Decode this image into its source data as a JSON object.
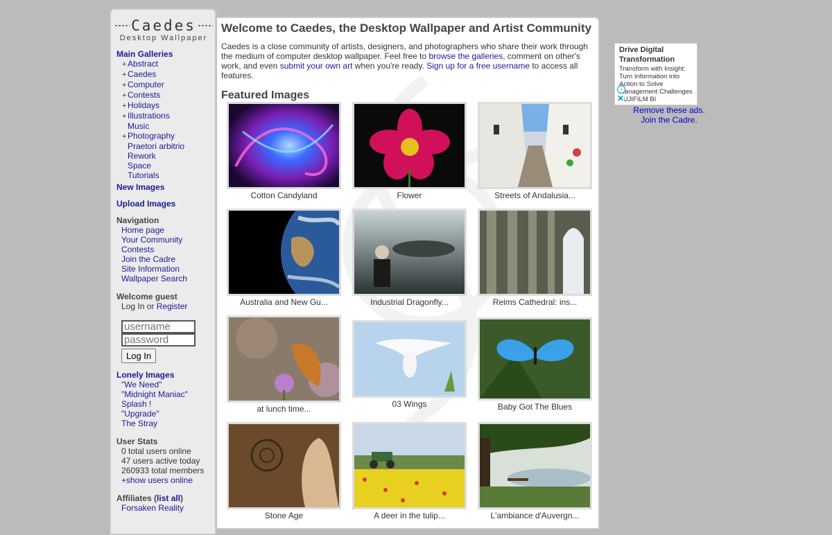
{
  "logo": {
    "brand": "Caedes",
    "subtitle": "Desktop Wallpaper"
  },
  "sidebar": {
    "main_galleries": {
      "title": "Main Galleries",
      "items": [
        {
          "label": "Abstract",
          "has_children": true
        },
        {
          "label": "Caedes",
          "has_children": true
        },
        {
          "label": "Computer",
          "has_children": true
        },
        {
          "label": "Contests",
          "has_children": true
        },
        {
          "label": "Holidays",
          "has_children": true
        },
        {
          "label": "Illustrations",
          "has_children": true
        },
        {
          "label": "Music",
          "has_children": false
        },
        {
          "label": "Photography",
          "has_children": true
        },
        {
          "label": "Praetori arbitrio",
          "has_children": false
        },
        {
          "label": "Rework",
          "has_children": false
        },
        {
          "label": "Space",
          "has_children": false
        },
        {
          "label": "Tutorials",
          "has_children": false
        }
      ]
    },
    "new_images": "New Images",
    "upload_images": "Upload Images",
    "navigation": {
      "title": "Navigation",
      "items": [
        "Home page",
        "Your Community",
        "Contests",
        "Join the Cadre",
        "Site Information",
        "Wallpaper Search"
      ]
    },
    "welcome": {
      "title": "Welcome guest",
      "login_link": "Log In",
      "or": "or",
      "register_link": "Register"
    },
    "login": {
      "username_placeholder": "username",
      "password_placeholder": "password",
      "button": "Log In"
    },
    "lonely_images": {
      "title": "Lonely Images",
      "items": [
        "\"We Need\"",
        "\"Midnight Maniac\"",
        "Splash !",
        "\"Upgrade\"",
        "The Stray"
      ]
    },
    "user_stats": {
      "title": "User Stats",
      "lines": [
        "0 total users online",
        "47 users active today",
        "260933 total members"
      ],
      "show_link": "+show users online"
    },
    "affiliates": {
      "title": "Affiliates",
      "list_all": "list all",
      "items": [
        "Forsaken Reality"
      ]
    }
  },
  "main": {
    "title": "Welcome to Caedes, the Desktop Wallpaper and Artist Community",
    "intro": {
      "p1": "Caedes is a close community of artists, designers, and photographers who share their work through the medium of computer desktop wallpaper. Feel free to ",
      "link1": "browse the galleries",
      "p2": ", comment on other's work, and even ",
      "link2": "submit your own art",
      "p3": " when you're ready. ",
      "link3": "Sign up for a free username",
      "p4": " to access all features."
    },
    "featured_title": "Featured Images",
    "featured": [
      {
        "caption": "Cotton Candyland"
      },
      {
        "caption": "Flower"
      },
      {
        "caption": "Streets of Andalusia..."
      },
      {
        "caption": "Australia and New Gu..."
      },
      {
        "caption": "Industrial Dragonfly..."
      },
      {
        "caption": "Reims Cathedral: ins..."
      },
      {
        "caption": "at lunch time..."
      },
      {
        "caption": "03 Wings"
      },
      {
        "caption": "Baby Got The Blues"
      },
      {
        "caption": "Stone Age"
      },
      {
        "caption": "A deer in the tulip..."
      },
      {
        "caption": "L'ambiance d'Auvergn..."
      }
    ]
  },
  "ad": {
    "headline": "Drive Digital Transformation",
    "body": "Transform with Insight: Turn Information into Action to Solve Management Challenges FUJIFILM BI",
    "remove_link": "Remove these ads.",
    "join_link": "Join the Cadre."
  }
}
